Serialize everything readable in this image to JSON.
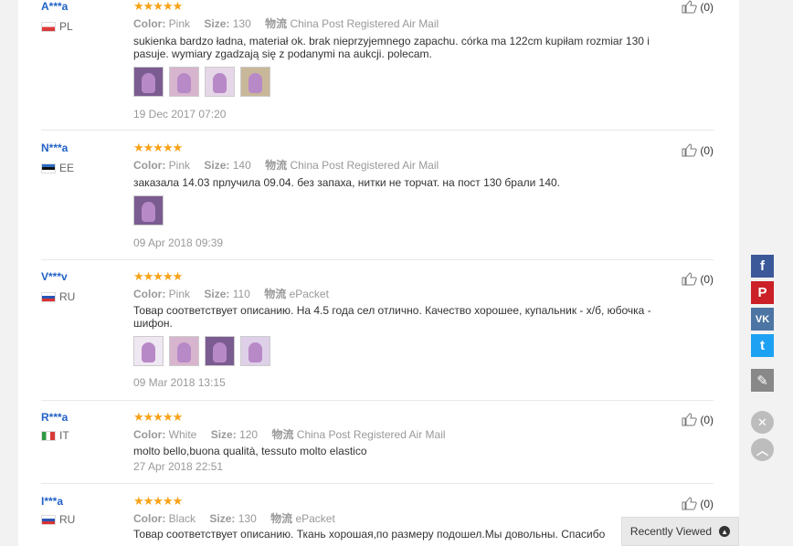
{
  "reviews": [
    {
      "name": "A***a",
      "country": "PL",
      "stars": "★★★★★",
      "color_label": "Color:",
      "color": "Pink",
      "size_label": "Size:",
      "size": "130",
      "shipping_label": "物流",
      "shipping": "China Post Registered Air Mail",
      "text": "sukienka bardzo ładna, materiał ok. brak nieprzyjemnego zapachu. córka ma 122cm kupiłam rozmiar 130 i pasuje. wymiary zgadzają się z podanymi na aukcji. polecam.",
      "date": "19 Dec 2017 07:20",
      "likes": "(0)"
    },
    {
      "name": "N***a",
      "country": "EE",
      "stars": "★★★★★",
      "color_label": "Color:",
      "color": "Pink",
      "size_label": "Size:",
      "size": "140",
      "shipping_label": "物流",
      "shipping": "China Post Registered Air Mail",
      "text": "заказала 14.03 прлучила 09.04. без запаха, нитки не торчат. на пост 130 брали 140.",
      "date": "09 Apr 2018 09:39",
      "likes": "(0)"
    },
    {
      "name": "V***v",
      "country": "RU",
      "stars": "★★★★★",
      "color_label": "Color:",
      "color": "Pink",
      "size_label": "Size:",
      "size": "110",
      "shipping_label": "物流",
      "shipping": "ePacket",
      "text": "Товар соответствует описанию. На 4.5 года сел отлично. Качество хорошее, купальник - х/б, юбочка - шифон.",
      "date": "09 Mar 2018 13:15",
      "likes": "(0)"
    },
    {
      "name": "R***a",
      "country": "IT",
      "stars": "★★★★★",
      "color_label": "Color:",
      "color": "White",
      "size_label": "Size:",
      "size": "120",
      "shipping_label": "物流",
      "shipping": "China Post Registered Air Mail",
      "text": "molto bello,buona qualità, tessuto molto elastico",
      "date": "27 Apr 2018 22:51",
      "likes": "(0)"
    },
    {
      "name": "I***a",
      "country": "RU",
      "stars": "★★★★★",
      "color_label": "Color:",
      "color": "Black",
      "size_label": "Size:",
      "size": "130",
      "shipping_label": "物流",
      "shipping": "ePacket",
      "text": "Товар соответствует описанию. Ткань хорошая,по размеру подошел.Мы довольны. Спасибо",
      "date": "",
      "likes": "(0)"
    }
  ],
  "share": {
    "facebook": "f",
    "pinterest": "P",
    "vk": "VK",
    "twitter": "t",
    "edit": "✎",
    "close": "✕",
    "top": "︿"
  },
  "recently_viewed": {
    "label": "Recently Viewed"
  },
  "colors": {
    "username": "#2262c6",
    "stars": "#f8a218",
    "facebook": "#3b5998",
    "pinterest": "#cb2027",
    "vk": "#4c75a3",
    "twitter": "#1da1f2"
  }
}
